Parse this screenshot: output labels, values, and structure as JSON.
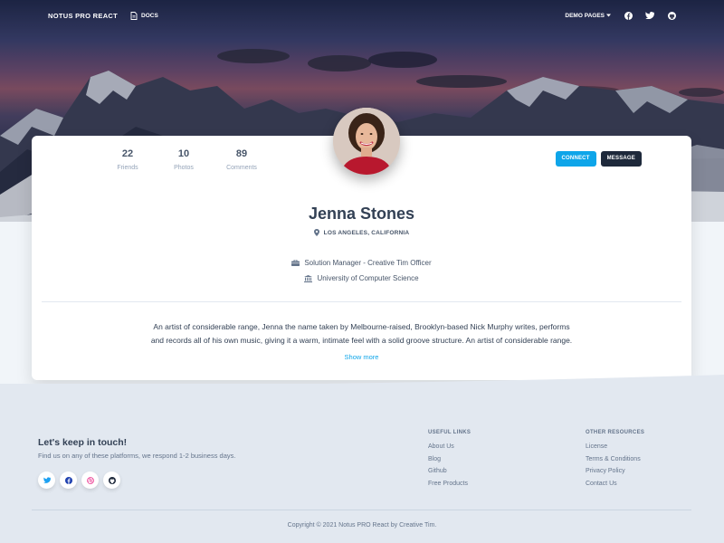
{
  "nav": {
    "brand": "Notus PRO React",
    "docs_label": "Docs",
    "demo_pages_label": "Demo Pages"
  },
  "profile": {
    "stats": [
      {
        "value": "22",
        "label": "Friends"
      },
      {
        "value": "10",
        "label": "Photos"
      },
      {
        "value": "89",
        "label": "Comments"
      }
    ],
    "connect_label": "Connect",
    "message_label": "Message",
    "name": "Jenna Stones",
    "location": "Los Angeles, California",
    "job": "Solution Manager - Creative Tim Officer",
    "education": "University of Computer Science",
    "bio_line1": "An artist of considerable range, Jenna the name taken by Melbourne-raised, Brooklyn-based Nick Murphy writes, performs",
    "bio_line2": "and records all of his own music, giving it a warm, intimate feel with a solid groove structure. An artist of considerable range.",
    "show_more": "Show more"
  },
  "footer": {
    "title": "Let's keep in touch!",
    "subtitle": "Find us on any of these platforms, we respond 1-2 business days.",
    "useful_links": {
      "heading": "Useful Links",
      "items": [
        "About Us",
        "Blog",
        "Github",
        "Free Products"
      ]
    },
    "other_resources": {
      "heading": "Other Resources",
      "items": [
        "License",
        "Terms & Conditions",
        "Privacy Policy",
        "Contact Us"
      ]
    },
    "copyright": "Copyright © 2021 Notus PRO React by Creative Tim."
  },
  "colors": {
    "accent": "#0ea5e9",
    "dark_button": "#1e293b"
  },
  "icons": [
    "docs-icon",
    "chevron-down-icon",
    "facebook-icon",
    "twitter-icon",
    "github-icon",
    "map-marker-icon",
    "briefcase-icon",
    "university-icon",
    "dribbble-icon"
  ]
}
